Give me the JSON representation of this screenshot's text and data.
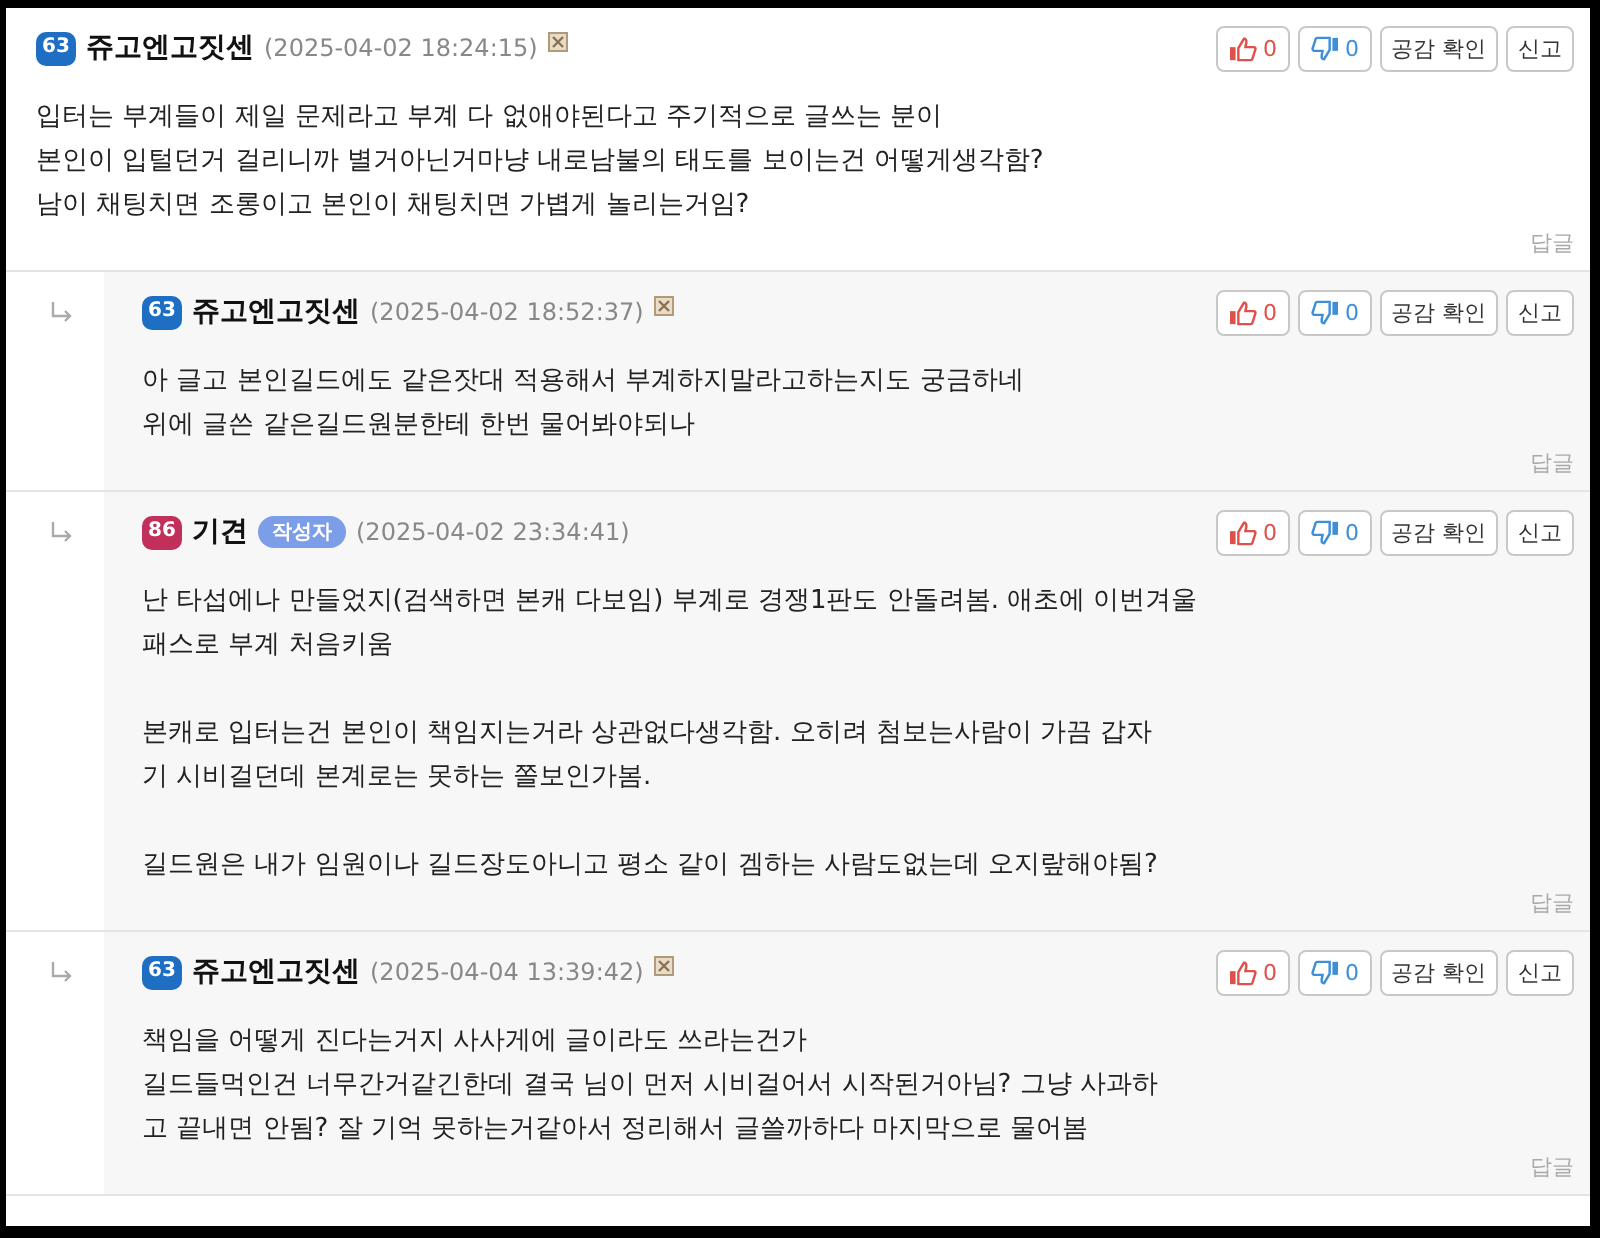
{
  "comments": [
    {
      "reply": false,
      "level": "63",
      "color": "#1e6fc4",
      "name": "쥬고엔고짓센",
      "date": "(2025-04-02 18:24:15)",
      "deletable": true,
      "likes": "0",
      "dislikes": "0",
      "empathy": "공감 확인",
      "report": "신고",
      "paragraphs": [
        [
          "입터는 부계들이 제일 문제라고 부계 다 없애야된다고 주기적으로 글쓰는 분이",
          "본인이 입털던거 걸리니까 별거아닌거마냥 내로남불의 태도를 보이는건 어떻게생각함?",
          "남이 채팅치면 조롱이고 본인이 채팅치면 가볍게 놀리는거임?"
        ]
      ],
      "reply_link": "답글"
    },
    {
      "reply": true,
      "level": "63",
      "color": "#1e6fc4",
      "name": "쥬고엔고짓센",
      "date": "(2025-04-02 18:52:37)",
      "deletable": true,
      "likes": "0",
      "dislikes": "0",
      "empathy": "공감 확인",
      "report": "신고",
      "paragraphs": [
        [
          "아 글고 본인길드에도 같은잣대 적용해서 부계하지말라고하는지도 궁금하네",
          "위에 글쓴 같은길드원분한테 한번 물어봐야되나"
        ]
      ],
      "reply_link": "답글"
    },
    {
      "reply": true,
      "level": "86",
      "color": "#c0305a",
      "name": "기견",
      "author_badge": "작성자",
      "date": "(2025-04-02 23:34:41)",
      "deletable": false,
      "likes": "0",
      "dislikes": "0",
      "empathy": "공감 확인",
      "report": "신고",
      "paragraphs": [
        [
          "난 타섭에나 만들었지(검색하면 본캐 다보임) 부계로 경쟁1판도 안돌려봄. 애초에 이번겨울",
          "패스로 부계 처음키움"
        ],
        [
          "본캐로 입터는건 본인이 책임지는거라 상관없다생각함. 오히려 첨보는사람이 가끔 갑자",
          "기 시비걸던데 본계로는 못하는 쫄보인가봄."
        ],
        [
          "길드원은 내가 임원이나 길드장도아니고 평소 같이 겜하는 사람도없는데 오지랖해야됨?"
        ]
      ],
      "reply_link": "답글"
    },
    {
      "reply": true,
      "level": "63",
      "color": "#1e6fc4",
      "name": "쥬고엔고짓센",
      "date": "(2025-04-04 13:39:42)",
      "deletable": true,
      "likes": "0",
      "dislikes": "0",
      "empathy": "공감 확인",
      "report": "신고",
      "paragraphs": [
        [
          "책임을 어떻게 진다는거지 사사게에 글이라도 쓰라는건가",
          "길드들먹인건 너무간거같긴한데 결국 님이 먼저 시비걸어서 시작된거아님? 그냥 사과하",
          "고 끝내면 안됨? 잘 기억 못하는거같아서 정리해서 글쓸까하다 마지막으로 물어봄"
        ]
      ],
      "reply_link": "답글"
    }
  ]
}
